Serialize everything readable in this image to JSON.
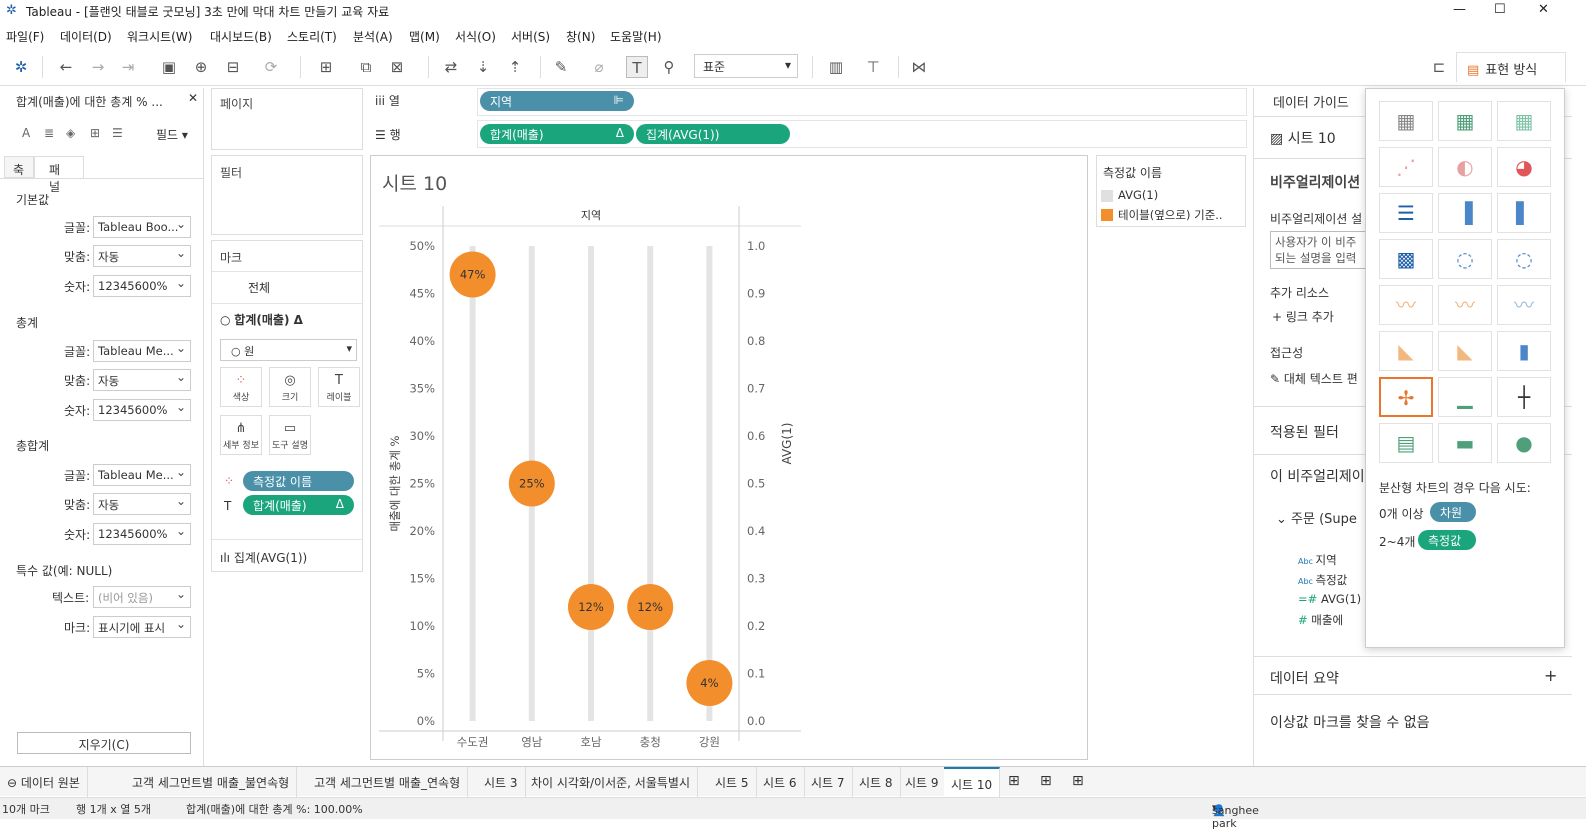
{
  "window": {
    "title": "Tableau - [플랜잇 태블로 굿모닝] 3초 만에 막대 차트 만들기 교육 자료"
  },
  "menu": [
    "파일(F)",
    "데이터(D)",
    "워크시트(W)",
    "대시보드(B)",
    "스토리(T)",
    "분석(A)",
    "맵(M)",
    "서식(O)",
    "서버(S)",
    "창(N)",
    "도움말(H)"
  ],
  "toolbar": {
    "fit": "표준",
    "showme": "표현 방식"
  },
  "format_pane": {
    "title": "합계(매출)에 대한 총계 % ...",
    "fields_label": "필드",
    "tabs": [
      "축",
      "패널"
    ],
    "sections": [
      {
        "name": "기본값",
        "font": "Tableau Boo...",
        "align": "자동",
        "number": "12345600%"
      },
      {
        "name": "총계",
        "font": "Tableau Me...",
        "align": "자동",
        "number": "12345600%"
      },
      {
        "name": "총합계",
        "font": "Tableau Me...",
        "align": "자동",
        "number": "12345600%"
      }
    ],
    "labels": {
      "font": "글꼴:",
      "align": "맞춤:",
      "number": "숫자:",
      "text": "텍스트:",
      "mark": "마크:"
    },
    "special": "특수 값(예: NULL)",
    "special_text_placeholder": "(비어 있음)",
    "special_mark": "표시기에 표시",
    "clear": "지우기(C)"
  },
  "cards": {
    "pages": "페이지",
    "filters": "필터",
    "marks": "마크",
    "all": "전체",
    "measure1": "합계(매출) Δ",
    "mark_type": "원",
    "buttons": [
      "색상",
      "크기",
      "레이블",
      "세부 정보",
      "도구 설명"
    ],
    "pill_color": "측정값 이름",
    "pill_label": "합계(매출)",
    "measure2": "집계(AVG(1))"
  },
  "shelves": {
    "columns_label": "열",
    "rows_label": "행",
    "columns": [
      "지역"
    ],
    "rows": [
      "합계(매출)",
      "집계(AVG(1))"
    ]
  },
  "sheet_title": "시트 10",
  "legend": {
    "title": "측정값 이름",
    "items": [
      {
        "label": "AVG(1)",
        "color": "#e0e0e0"
      },
      {
        "label": "테이블(옆으로) 기준..",
        "color": "#f28e2b"
      }
    ]
  },
  "chart_data": {
    "type": "scatter",
    "title": "시트 10",
    "column_header": "지역",
    "categories": [
      "수도권",
      "영남",
      "호남",
      "충청",
      "강원"
    ],
    "series": [
      {
        "name": "테이블(옆으로) 기준..",
        "values": [
          0.47,
          0.25,
          0.12,
          0.12,
          0.04
        ],
        "labels": [
          "47%",
          "25%",
          "12%",
          "12%",
          "4%"
        ]
      },
      {
        "name": "AVG(1)",
        "values": [
          1,
          1,
          1,
          1,
          1
        ]
      }
    ],
    "ylabel_left": "매출에 대한 총계 %",
    "ylabel_right": "AVG(1)",
    "ylim_left": [
      0,
      0.5
    ],
    "ylim_right": [
      0,
      1.0
    ],
    "yticks_left": [
      "0%",
      "5%",
      "10%",
      "15%",
      "20%",
      "25%",
      "30%",
      "35%",
      "40%",
      "45%",
      "50%"
    ],
    "yticks_right": [
      "0.0",
      "0.1",
      "0.2",
      "0.3",
      "0.4",
      "0.5",
      "0.6",
      "0.7",
      "0.8",
      "0.9",
      "1.0"
    ]
  },
  "guide": {
    "title": "데이터 가이드",
    "sheet": "시트 10",
    "viz_heading": "비주얼리제이션",
    "viz_desc_label": "비주얼리제이션 설",
    "desc_placeholder": "사용자가 이 비주\n되는 설명을 입력",
    "resources": "추가 리소스",
    "add_link": "링크 추가",
    "accessibility": "접근성",
    "alt_text": "대체 텍스트 편",
    "filters": "적용된 필터",
    "this_viz": "이 비주얼리제이",
    "datasource": "주문 (Supe",
    "fields": [
      "지역",
      "측정값",
      "AVG(1)",
      "매출에"
    ],
    "summary": "데이터 요약",
    "outliers": "이상값 마크를 찾을 수 없음"
  },
  "showme": {
    "hint": "분산형 차트의 경우 다음 시도:",
    "req1_count": "0개 이상",
    "req1_pill": "차원",
    "req2_count": "2~4개",
    "req2_pill": "측정값"
  },
  "tabs": [
    "데이터 원본",
    "고객 세그먼트별 매출_불연속형",
    "고객 세그먼트별 매출_연속형",
    "시트 3",
    "차이 시각화/이서준, 서울특별시",
    "시트 5",
    "시트 6",
    "시트 7",
    "시트 8",
    "시트 9",
    "시트 10"
  ],
  "status": {
    "marks": "10개 마크",
    "rows_cols": "행 1개 x 열 5개",
    "sum": "합계(매출)에 대한 총계 %: 100.00%",
    "user": "sanghee park"
  }
}
